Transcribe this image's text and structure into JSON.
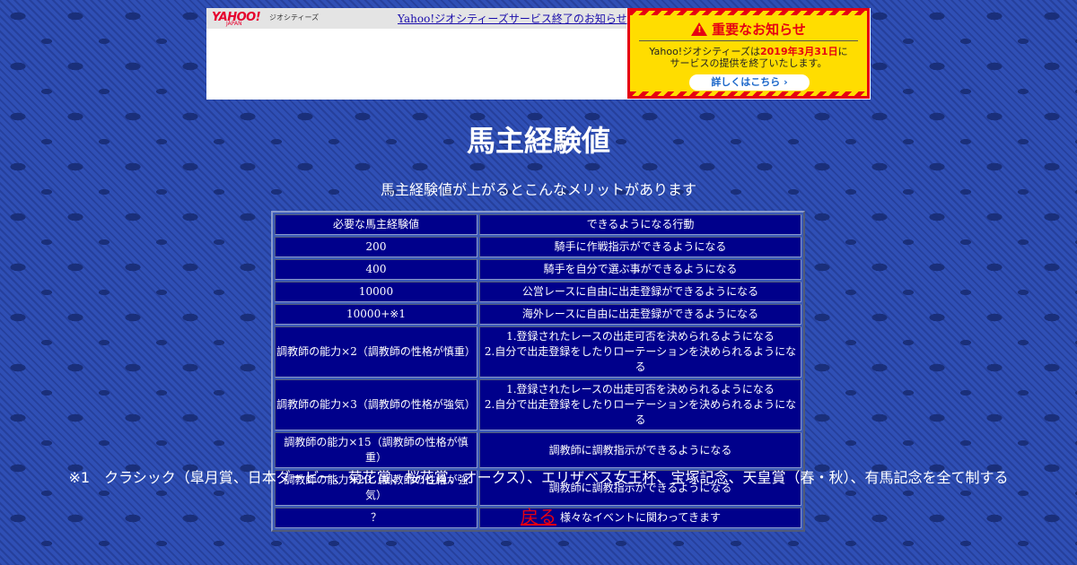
{
  "yahoo_bar": {
    "logo": "YAHOO!",
    "logo_sub": "JAPAN",
    "geo_label": "ジオシティーズ",
    "notice_link": "Yahoo!ジオシティーズサービス終了のお知らせ",
    "banner": {
      "title": "重要なお知らせ",
      "body_prefix": "Yahoo!ジオシティーズは",
      "date": "2019年3月31日",
      "body_suffix": "に",
      "body_line2": "サービスの提供を終了いたします。",
      "details_button": "詳しくはこちら ›"
    }
  },
  "page": {
    "title": "馬主経験値",
    "intro": "馬主経験値が上がるとこんなメリットがあります",
    "table": {
      "headers": [
        "必要な馬主経験値",
        "できるようになる行動"
      ],
      "rows": [
        [
          "200",
          "騎手に作戦指示ができるようになる",
          ""
        ],
        [
          "400",
          "騎手を自分で選ぶ事ができるようになる",
          ""
        ],
        [
          "10000",
          "公営レースに自由に出走登録ができるようになる",
          ""
        ],
        [
          "10000+※1",
          "海外レースに自由に出走登録ができるようになる",
          ""
        ],
        [
          "調教師の能力×2（調教師の性格が慎重）",
          "1.登録されたレースの出走可否を決められるようになる",
          "2.自分で出走登録をしたりローテーションを決められるようになる"
        ],
        [
          "調教師の能力×3（調教師の性格が強気）",
          "1.登録されたレースの出走可否を決められるようになる",
          "2.自分で出走登録をしたりローテーションを決められるようになる"
        ],
        [
          "調教師の能力×15（調教師の性格が慎重）",
          "調教師に調教指示ができるようになる",
          ""
        ],
        [
          "調教師の能力×20（調教師の性格が強気）",
          "調教師に調教指示ができるようになる",
          ""
        ],
        [
          "？",
          "様々なイベントに関わってきます",
          ""
        ]
      ]
    },
    "footnote": "※1　クラシック（皐月賞、日本ダービー、菊花賞、桜花賞、オークス）、エリザベス女王杯、宝塚記念、天皇賞（春・秋）、有馬記念を全て制する",
    "back_link": "戻る"
  },
  "colors": {
    "background": "#2f4fb5",
    "table_cell": "#00008b",
    "alert_red": "#e60012",
    "alert_yellow": "#ffdd00"
  }
}
